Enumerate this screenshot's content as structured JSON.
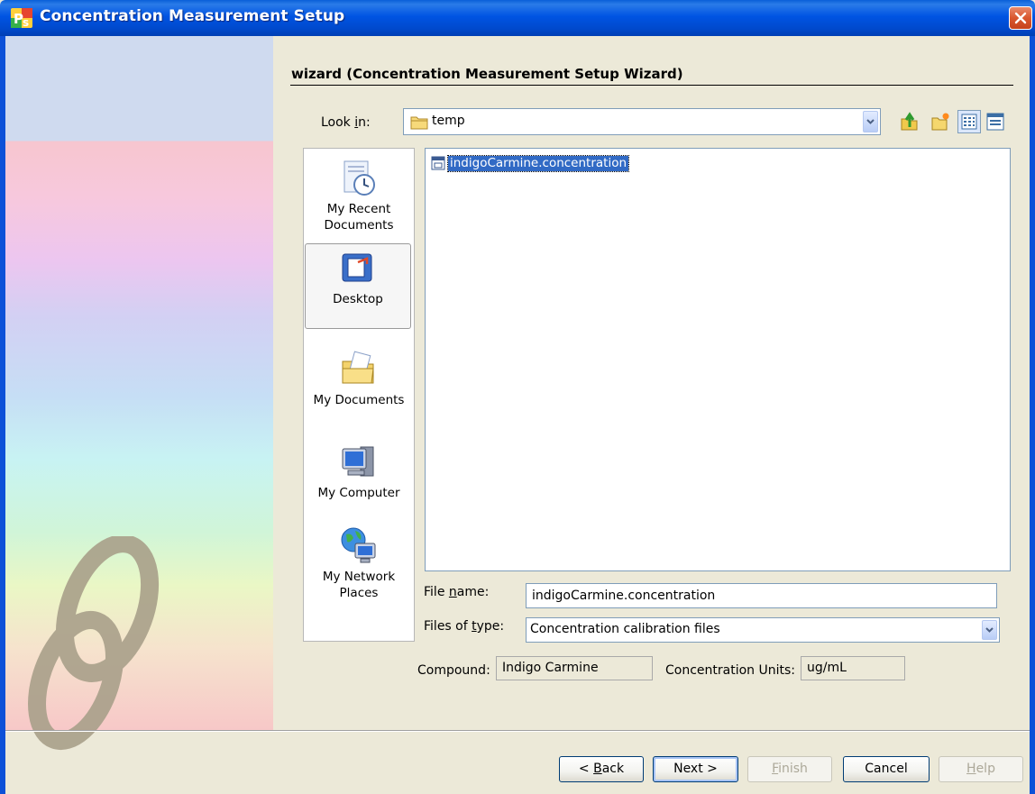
{
  "window": {
    "title": "Concentration Measurement Setup"
  },
  "wizard": {
    "heading": "wizard (Concentration Measurement Setup Wizard)"
  },
  "look_in": {
    "label_pre": "Look ",
    "label_u": "i",
    "label_post": "n:",
    "value": "temp"
  },
  "places": [
    {
      "line1": "My Recent",
      "line2": "Documents",
      "icon": "recent-documents-icon"
    },
    {
      "line1": "Desktop",
      "line2": "",
      "icon": "desktop-icon"
    },
    {
      "line1": "My Documents",
      "line2": "",
      "icon": "my-documents-icon"
    },
    {
      "line1": "My Computer",
      "line2": "",
      "icon": "my-computer-icon"
    },
    {
      "line1": "My Network",
      "line2": "Places",
      "icon": "my-network-places-icon"
    }
  ],
  "files": [
    {
      "name": "indigoCarmine.concentration",
      "selected": true
    }
  ],
  "file_name": {
    "label_pre": "File ",
    "label_u": "n",
    "label_post": "ame:",
    "value": "indigoCarmine.concentration"
  },
  "file_type": {
    "label_pre": "Files of ",
    "label_u": "t",
    "label_post": "ype:",
    "value": "Concentration calibration files"
  },
  "compound": {
    "label": "Compound:",
    "value": "Indigo Carmine"
  },
  "units": {
    "label": "Concentration Units:",
    "value": "ug/mL"
  },
  "buttons": {
    "back_pre": "< ",
    "back_u": "B",
    "back_post": "ack",
    "next": "Next >",
    "finish_u": "F",
    "finish_post": "inish",
    "cancel": "Cancel",
    "help_u": "H",
    "help_post": "elp"
  },
  "colors": {
    "title_bar": "#0054e3",
    "selection": "#316ac5",
    "face": "#ece9d8"
  }
}
